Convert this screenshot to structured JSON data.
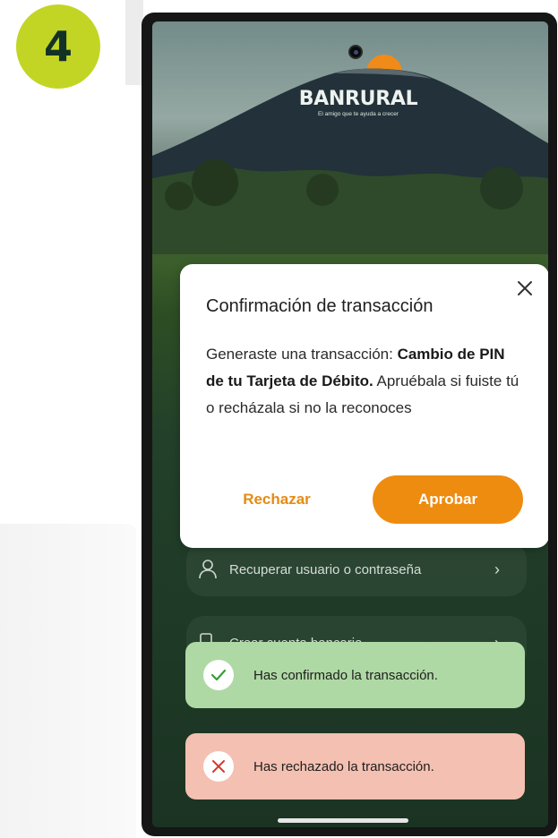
{
  "step": {
    "number": "4"
  },
  "app": {
    "brand_name": "BANRURAL",
    "brand_slogan": "El amigo que te ayuda a crecer"
  },
  "menu": {
    "items": [
      {
        "label": "Recuperar usuario o contraseña",
        "icon": "user-icon"
      },
      {
        "label": "Crear cuenta bancaria",
        "icon": "phone-account-icon"
      }
    ]
  },
  "dialog": {
    "title": "Confirmación de transacción",
    "body_prefix": "Generaste una transacción: ",
    "body_highlight": "Cambio de PIN de tu Tarjeta de Débito.",
    "body_suffix": " Apruébala si fuiste tú o recházala si no la reconoces",
    "reject_label": "Rechazar",
    "approve_label": "Aprobar"
  },
  "toasts": {
    "success": "Has confirmado la transacción.",
    "error": "Has rechazado la transacción."
  },
  "colors": {
    "step_badge": "#c3d524",
    "accent_orange": "#ee8c10",
    "success_bg": "#afd9a4",
    "error_bg": "#f4c0b1",
    "success_icon": "#3a9a3a",
    "error_icon": "#d63a2a"
  }
}
